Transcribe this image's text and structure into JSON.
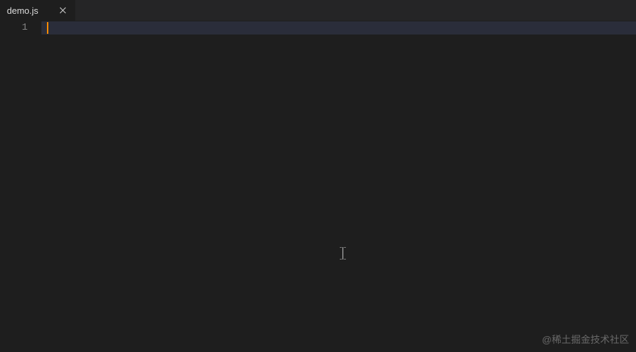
{
  "tabs": [
    {
      "label": "demo.js",
      "active": true,
      "dirty": false
    }
  ],
  "editor": {
    "lineNumbers": [
      "1"
    ],
    "currentLine": 1,
    "content": ""
  },
  "watermark": "@稀土掘金技术社区"
}
